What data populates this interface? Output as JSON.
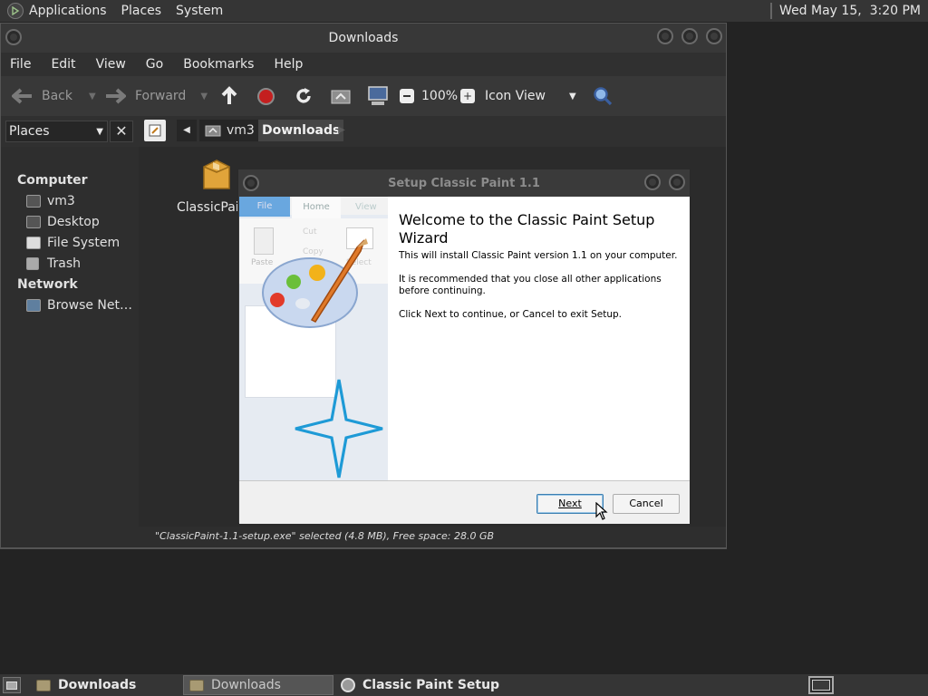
{
  "top_panel": {
    "menus": [
      "Applications",
      "Places",
      "System"
    ],
    "clock": "Wed May 15,  3:20 PM"
  },
  "file_manager": {
    "title": "Downloads",
    "menubar": [
      "File",
      "Edit",
      "View",
      "Go",
      "Bookmarks",
      "Help"
    ],
    "toolbar": {
      "back": "Back",
      "forward": "Forward",
      "zoom": "100%",
      "view_mode": "Icon View"
    },
    "places_combo": "Places",
    "path": [
      "vm3",
      "Downloads"
    ],
    "sidebar": {
      "computer_heading": "Computer",
      "computer_items": [
        {
          "label": "vm3",
          "icon": "home-folder-icon"
        },
        {
          "label": "Desktop",
          "icon": "desktop-folder-icon"
        },
        {
          "label": "File System",
          "icon": "drive-icon"
        },
        {
          "label": "Trash",
          "icon": "trash-icon"
        }
      ],
      "network_heading": "Network",
      "network_items": [
        {
          "label": "Browse Net…",
          "icon": "network-icon"
        }
      ]
    },
    "files": [
      {
        "name": "ClassicPain",
        "icon": "package-icon"
      }
    ],
    "status": "\"ClassicPaint-1.1-setup.exe\" selected (4.8 MB), Free space: 28.0 GB"
  },
  "setup_dialog": {
    "title": "Setup Classic Paint 1.1",
    "heading": "Welcome to the Classic Paint Setup Wizard",
    "para1": "This will install Classic Paint version 1.1 on your computer.",
    "para2": "It is recommended that you close all other applications before continuing.",
    "para3": "Click Next to continue, or Cancel to exit Setup.",
    "next_label": "Next",
    "cancel_label": "Cancel",
    "side_image_tabs": [
      "File",
      "Home",
      "View"
    ],
    "side_image_labels": [
      "Paste",
      "Cut",
      "Copy",
      "Select"
    ]
  },
  "taskbar": {
    "tasks": [
      {
        "label": "Downloads",
        "active": false
      },
      {
        "label": "Downloads",
        "active": true
      },
      {
        "label": "Classic Paint Setup",
        "active": false
      }
    ]
  },
  "colors": {
    "panel_bg": "#353535",
    "window_bg": "#2e2e2e",
    "star_accent": "#1e9ad6",
    "file_tab_blue": "#3c8fd9"
  }
}
